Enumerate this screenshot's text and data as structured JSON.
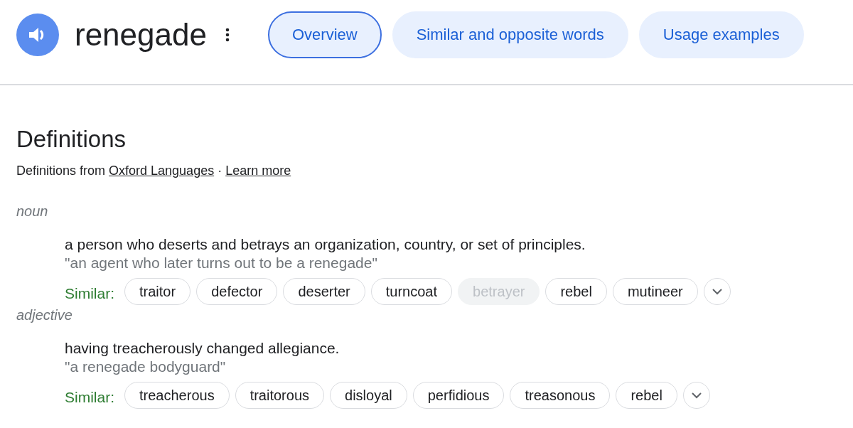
{
  "header": {
    "word": "renegade"
  },
  "tabs": [
    {
      "label": "Overview",
      "selected": true
    },
    {
      "label": "Similar and opposite words",
      "selected": false
    },
    {
      "label": "Usage examples",
      "selected": false
    }
  ],
  "definitions": {
    "title": "Definitions",
    "source_prefix": "Definitions from",
    "source_link": "Oxford Languages",
    "separator": "·",
    "learn_more": "Learn more",
    "senses": [
      {
        "part_of_speech": "noun",
        "definition": "a person who deserts and betrays an organization, country, or set of principles.",
        "example": "\"an agent who later turns out to be a renegade\"",
        "similar_label": "Similar:",
        "similar": [
          {
            "word": "traitor",
            "disabled": false
          },
          {
            "word": "defector",
            "disabled": false
          },
          {
            "word": "deserter",
            "disabled": false
          },
          {
            "word": "turncoat",
            "disabled": false
          },
          {
            "word": "betrayer",
            "disabled": true
          },
          {
            "word": "rebel",
            "disabled": false
          },
          {
            "word": "mutineer",
            "disabled": false
          }
        ]
      },
      {
        "part_of_speech": "adjective",
        "definition": "having treacherously changed allegiance.",
        "example": "\"a renegade bodyguard\"",
        "similar_label": "Similar:",
        "similar": [
          {
            "word": "treacherous",
            "disabled": false
          },
          {
            "word": "traitorous",
            "disabled": false
          },
          {
            "word": "disloyal",
            "disabled": false
          },
          {
            "word": "perfidious",
            "disabled": false
          },
          {
            "word": "treasonous",
            "disabled": false
          },
          {
            "word": "rebel",
            "disabled": false
          }
        ]
      }
    ]
  }
}
